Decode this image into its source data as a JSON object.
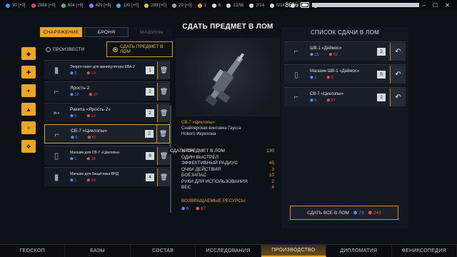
{
  "topbar": {
    "resources": [
      {
        "icon": "credits-icon",
        "text": "90 [+0]",
        "color": "#3aa0e0"
      },
      {
        "icon": "energy-icon",
        "text": "2988 [+0]",
        "color": "#e84a4a"
      },
      {
        "icon": "materials-icon",
        "text": "604 [+9]",
        "color": "#4fc04f"
      },
      {
        "icon": "tech-icon",
        "text": "429 [+8]",
        "color": "#b46ee8"
      },
      {
        "icon": "supplies-icon",
        "text": "100 [+0]",
        "color": "#4fb0f0"
      },
      {
        "icon": "fuel-icon",
        "text": "289 [+0]",
        "color": "#e8c030"
      },
      {
        "icon": "parts-icon",
        "text": "29 [+0]",
        "color": "#a0a8b0"
      },
      {
        "icon": "info-icon",
        "text": "1",
        "color": "#e9a628"
      },
      {
        "icon": "soldier-icon",
        "text": "6",
        "color": "#d8dde3"
      },
      {
        "icon": "squad-icon",
        "text": "22/56",
        "color": "#d8dde3"
      },
      {
        "icon": "vehicle-icon",
        "text": "2/14",
        "color": "#d8dde3"
      },
      {
        "icon": "aircraft-icon",
        "text": "0/14",
        "color": "#d8dde3"
      },
      {
        "icon": "storage-icon",
        "text": "12/50",
        "color": "#d8dde3"
      },
      {
        "icon": "power-icon",
        "text": "294/1600",
        "color": "#d8dde3"
      }
    ],
    "battery": "86%"
  },
  "tabs": {
    "equipment": "СНАРЯЖЕНИЕ",
    "armor": "БРОНЯ",
    "vehicles": "МАШИНЫ"
  },
  "modes": {
    "produce": "ПРОИЗВЕСТИ",
    "scrap_line1": "СДАТЬ ПРЕДМЕТ В",
    "scrap_line2": "ЛОМ"
  },
  "items": [
    {
      "name": "Энерго-пакет для манипулятора ЕВА-2",
      "blue": "5",
      "red": "10",
      "qty": "1",
      "icon": "battery-icon",
      "small": true
    },
    {
      "name": "Ярость-2",
      "blue": "12",
      "red": "37",
      "qty": "2",
      "icon": "launcher-icon"
    },
    {
      "name": "Ракета «Ярость-2»",
      "blue": "5",
      "red": "12",
      "qty": "2",
      "icon": "rocket-icon"
    },
    {
      "name": "СВ-7 «Циклопы»",
      "blue": "6",
      "red": "67",
      "qty": "2",
      "icon": "rifle-icon",
      "selected": true
    },
    {
      "name": "Магазин для СВ-7 «Циклопы»",
      "blue": "1",
      "red": "10",
      "qty": "9",
      "icon": "magazine-icon",
      "small": true
    },
    {
      "name": "Магазин для Защитника ВНД",
      "blue": "1",
      "red": "10",
      "qty": "4",
      "icon": "clip-icon",
      "small": true
    }
  ],
  "tooltip": "СДАТЬ ПРЕДМЕТ В ЛОМ",
  "detail": {
    "title": "СДАТЬ ПРЕДМЕТ В ЛОМ",
    "name": "СВ-7 «Циклопы»",
    "line2": "Снайперская винтовка Гаусса",
    "line3": "Нового Иерихона",
    "stats": [
      {
        "label": "УРОН",
        "value": "130"
      },
      {
        "label": "ОДИН ВЫСТРЕЛ",
        "value": ""
      },
      {
        "label": "ЭФФЕКТИВНЫЙ РАДИУС",
        "value": "45"
      },
      {
        "label": "ОЧКИ ДЕЙСТВИЯ",
        "value": "3"
      },
      {
        "label": "БОЕЗАПАС",
        "value": "10"
      },
      {
        "label": "РУКИ ДЛЯ ИСПОЛЬЗОВАНИЯ",
        "value": "2"
      },
      {
        "label": "ВЕС",
        "value": "4"
      }
    ],
    "returned_label": "ВОЗВРАЩАЕМЫЕ РЕСУРСЫ",
    "returned_blue": "6",
    "returned_red": "67"
  },
  "scrap_list": {
    "title": "СПИСОК СДАЧИ В ЛОМ",
    "items": [
      {
        "name": "ШВ-1 «Деймос»",
        "blue": "15",
        "red": "52",
        "qty": "2",
        "icon": "rifle-icon"
      },
      {
        "name": "Магазин ШВ-1 «Деймос»",
        "blue": "1",
        "red": "8",
        "qty": "5",
        "icon": "magazine-icon"
      },
      {
        "name": "СВ-7 «Циклопы»",
        "blue": "6",
        "red": "67",
        "qty": "2",
        "icon": "rifle-icon"
      }
    ],
    "scrap_all_label": "СДАТЬ ВСЕ В ЛОМ",
    "total_blue": "73",
    "total_red": "243"
  },
  "bottom_nav": [
    {
      "label": "ГЕОСКОП",
      "active": false
    },
    {
      "label": "БАЗЫ",
      "active": false
    },
    {
      "label": "СОСТАВ",
      "active": false
    },
    {
      "label": "ИССЛЕДОВАНИЯ",
      "active": false
    },
    {
      "label": "ПРОИЗВОДСТВО",
      "active": true
    },
    {
      "label": "ДИПЛОМАТИЯ",
      "active": false
    },
    {
      "label": "ФЕНИКСОПЕДИЯ",
      "active": false
    }
  ],
  "colors": {
    "accent": "#e9a628",
    "blue_resource": "#4f8df0",
    "red_resource": "#e0553a"
  }
}
